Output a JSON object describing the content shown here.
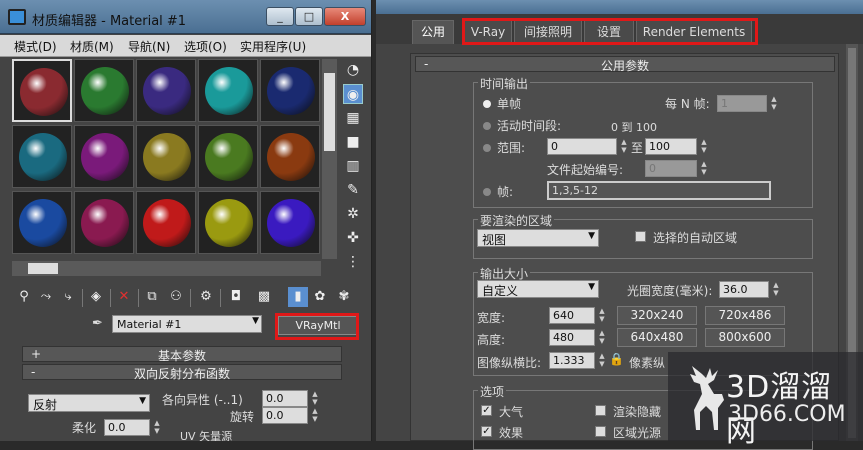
{
  "material_editor": {
    "title": "材质编辑器 - Material #1",
    "menu": [
      "模式(D)",
      "材质(M)",
      "导航(N)",
      "选项(O)",
      "实用程序(U)"
    ],
    "window_controls": [
      "_",
      "□",
      "X"
    ],
    "slots": [
      {
        "color": "#8a2a30"
      },
      {
        "color": "#2a7a30"
      },
      {
        "color": "#3a2a80"
      },
      {
        "color": "#1a9a9a"
      },
      {
        "color": "#1a2a70"
      },
      {
        "color": "#1a6a80"
      },
      {
        "color": "#7a1a7a"
      },
      {
        "color": "#8a7a20"
      },
      {
        "color": "#4a7a20"
      },
      {
        "color": "#8a3a10"
      },
      {
        "color": "#1a4aa0"
      },
      {
        "color": "#8a1a50"
      },
      {
        "color": "#c01a1a"
      },
      {
        "color": "#9a9a10"
      },
      {
        "color": "#3a1ac0"
      }
    ],
    "material_name": "Material #1",
    "material_type": "VRayMtl",
    "rollout_basic": "基本参数",
    "rollout_brdf": "双向反射分布函数",
    "brdf_type": "反射",
    "anisotropy_label": "各向异性 (-..1)",
    "anisotropy_value": "0.0",
    "rotation_label": "旋转",
    "rotation_value": "0.0",
    "soften_label": "柔化",
    "soften_value": "0.0",
    "uv_label": "UV 矢量源",
    "plus": "+",
    "minus": "-"
  },
  "render_settings": {
    "tabs": [
      "公用",
      "V-Ray",
      "间接照明",
      "设置",
      "Render Elements"
    ],
    "rollout_title": "公用参数",
    "time_output": {
      "label": "时间输出",
      "single": "单帧",
      "every_n_label": "每 N 帧:",
      "every_n_value": "1",
      "active_segment": "活动时间段:",
      "active_range": "0 到 100",
      "range": "范围:",
      "range_from": "0",
      "to": "至",
      "range_to": "100",
      "file_start_label": "文件起始编号:",
      "file_start_value": "0",
      "frames": "帧:",
      "frames_value": "1,3,5-12"
    },
    "area": {
      "label": "要渲染的区域",
      "value": "视图",
      "auto_region": "选择的自动区域"
    },
    "output_size": {
      "label": "输出大小",
      "preset": "自定义",
      "aperture_label": "光圈宽度(毫米):",
      "aperture_value": "36.0",
      "width_label": "宽度:",
      "width_value": "640",
      "height_label": "高度:",
      "height_value": "480",
      "presets": [
        "320x240",
        "720x486",
        "640x480",
        "800x600"
      ],
      "aspect_label": "图像纵横比:",
      "aspect_value": "1.333",
      "pixel_aspect_label": "像素纵"
    },
    "options": {
      "label": "选项",
      "atmosphere": "大气",
      "effects": "效果",
      "render_hidden": "渲染隐藏",
      "area_lights": "区域光源"
    }
  },
  "watermark": {
    "line1": "3D溜溜网",
    "line2": "3D66.COM"
  }
}
